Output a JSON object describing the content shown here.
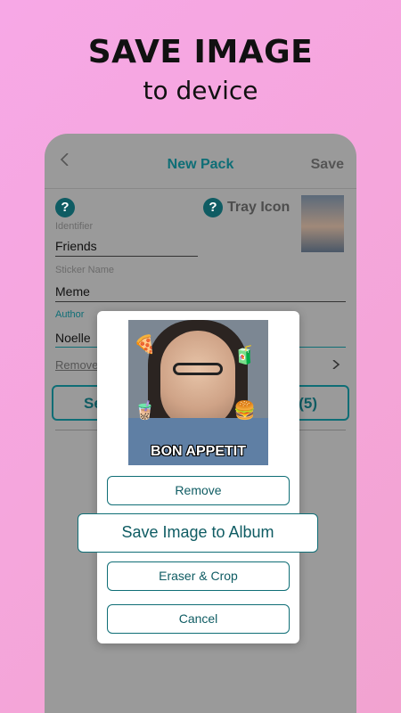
{
  "promo": {
    "title": "SAVE IMAGE",
    "subtitle": "to device"
  },
  "appbar": {
    "title": "New Pack",
    "save_label": "Save"
  },
  "form": {
    "tray_icon_label": "Tray Icon",
    "identifier_label": "Identifier",
    "identifier_value": "Friends",
    "sticker_name_label": "Sticker Name",
    "sticker_name_value": "Meme",
    "author_label": "Author",
    "author_value": "Noelle",
    "remove_label": "Remove",
    "button_left_text": "Se",
    "button_right_text": "(5)"
  },
  "dialog": {
    "sticker_caption": "BON APPETIT",
    "remove_label": "Remove",
    "save_album_label": "Save Image to Album",
    "eraser_crop_label": "Eraser & Crop",
    "cancel_label": "Cancel"
  },
  "colors": {
    "accent": "#0f6e76",
    "background": "#f5a6dc"
  }
}
